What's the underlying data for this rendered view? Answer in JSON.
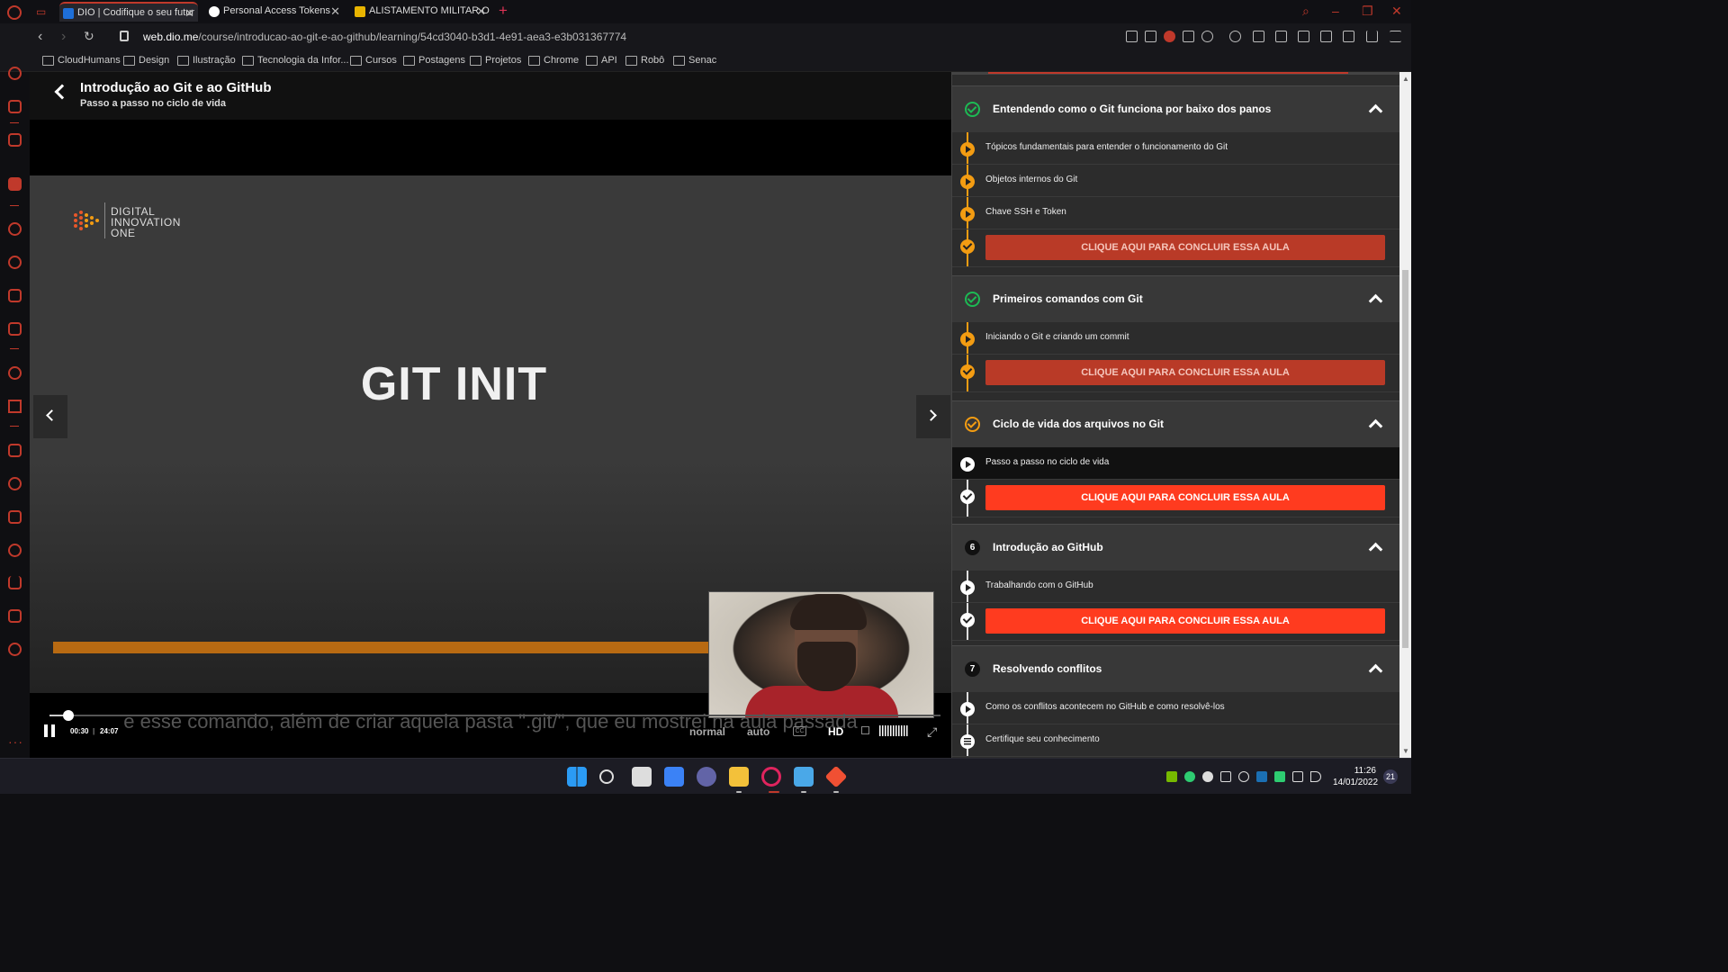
{
  "browser": {
    "tabs": [
      {
        "label": "DIO | Codifique o seu futur",
        "active": true,
        "favicon_color": "#1e6fd9"
      },
      {
        "label": "Personal Access Tokens",
        "active": false,
        "favicon_color": "#ffffff"
      },
      {
        "label": "ALISTAMENTO MILITAR ON",
        "active": false,
        "favicon_color": "#e8b400"
      }
    ],
    "url_domain": "web.dio.me",
    "url_path": "/course/introducao-ao-git-e-ao-github/learning/54cd3040-b3d1-4e91-aea3-e3b031367774",
    "bookmarks": [
      "CloudHumans",
      "Design",
      "Ilustração",
      "Tecnologia da Infor...",
      "Cursos",
      "Postagens",
      "Projetos",
      "Chrome",
      "API",
      "Robô",
      "Senac"
    ]
  },
  "header": {
    "course_title": "Introdução ao Git e ao GitHub",
    "lesson_subtitle": "Passo a passo no ciclo de vida"
  },
  "video": {
    "brand_lines": [
      "DIGITAL",
      "INNOVATION",
      "ONE"
    ],
    "slide_text": "GIT INIT",
    "caption": "e esse comando, além de criar aquela pasta \".git/\", que eu mostrei na aula passada",
    "current_time": "00:30",
    "separator": "|",
    "duration": "24:07",
    "speed": "normal",
    "quality_mode": "auto",
    "cc": "CC",
    "hd": "HD",
    "progress_fraction": 0.021
  },
  "panel": {
    "sections": [
      {
        "status": "completed",
        "title": "Entendendo como o Git funciona por baixo dos panos",
        "lessons": [
          "Tópicos fundamentais para entender o funcionamento do Git",
          "Objetos internos do Git",
          "Chave SSH e Token"
        ],
        "button": "CLIQUE AQUI PARA CONCLUIR ESSA AULA"
      },
      {
        "status": "completed",
        "title": "Primeiros comandos com Git",
        "lessons": [
          "Iniciando o Git e criando um commit"
        ],
        "button": "CLIQUE AQUI PARA CONCLUIR ESSA AULA"
      },
      {
        "status": "in-progress",
        "title": "Ciclo de vida dos arquivos no Git",
        "lessons": [
          "Passo a passo no ciclo de vida"
        ],
        "button": "CLIQUE AQUI PARA CONCLUIR ESSA AULA"
      },
      {
        "status": "pending",
        "number": "6",
        "title": "Introdução ao GitHub",
        "lessons": [
          "Trabalhando com o GitHub"
        ],
        "button": "CLIQUE AQUI PARA CONCLUIR ESSA AULA"
      },
      {
        "status": "pending",
        "number": "7",
        "title": "Resolvendo conflitos",
        "lessons": [
          "Como os conflitos acontecem no GitHub e como resolvê-los"
        ],
        "quiz": "Certifique seu conhecimento"
      }
    ]
  },
  "taskbar": {
    "time": "11:26",
    "date": "14/01/2022",
    "notifications": "21"
  },
  "colors": {
    "accent": "#c0392b",
    "progress_orange": "#f39c12",
    "button_red": "#ff3b1f",
    "completed_green": "#1db954"
  }
}
